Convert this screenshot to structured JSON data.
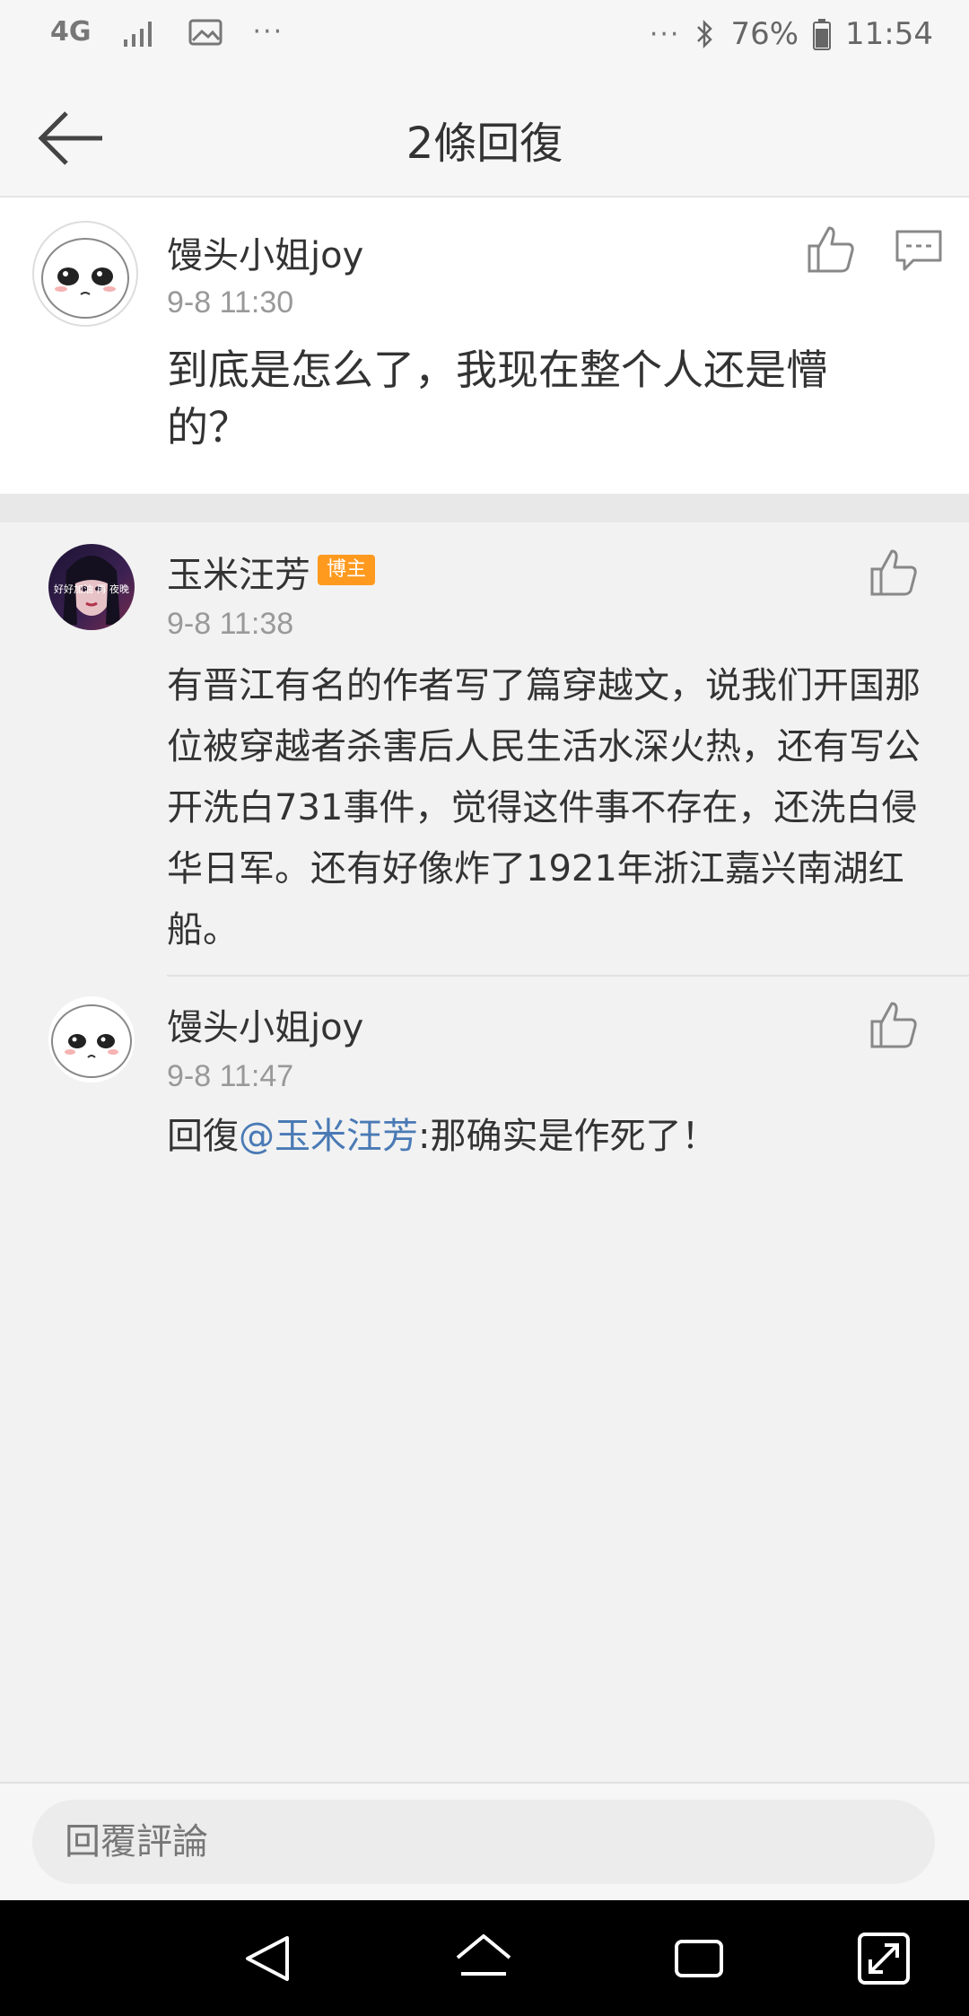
{
  "status_bar": {
    "network": "4G",
    "more": "···",
    "right_more": "···",
    "battery": "76%",
    "time": "11:54"
  },
  "header": {
    "title": "2條回復"
  },
  "main_comment": {
    "author": "馒头小姐joy",
    "time": "9-8 11:30",
    "text": "到底是怎么了，我现在整个人还是懵的？"
  },
  "replies": [
    {
      "author": "玉米汪芳",
      "badge": "博主",
      "time": "9-8 11:38",
      "avatar_caption": "好好加油 再 夜晚",
      "text": "有晋江有名的作者写了篇穿越文，说我们开国那位被穿越者杀害后人民生活水深火热，还有写公开洗白731事件，觉得这件事不存在，还洗白侵华日军。还有好像炸了1921年浙江嘉兴南湖红船。"
    },
    {
      "author": "馒头小姐joy",
      "time": "9-8 11:47",
      "reply_prefix": "回復",
      "mention": "@玉米汪芳",
      "text": ":那确实是作死了！"
    }
  ],
  "reply_bar": {
    "placeholder": "回覆評論"
  },
  "icons": {
    "back": "arrow-left-icon",
    "like": "thumbs-up-icon",
    "comment": "comment-bubble-icon"
  },
  "colors": {
    "badge": "#ff9a1f",
    "mention": "#4a7ab5"
  }
}
